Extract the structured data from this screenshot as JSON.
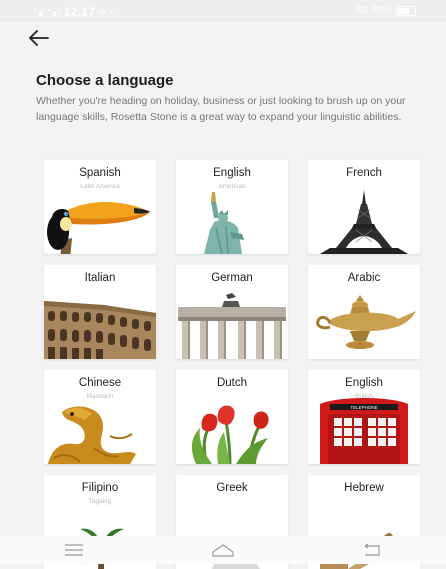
{
  "status_bar": {
    "signal_left": "\"∎",
    "signal_carrier": "\"∎l",
    "time": "12.17",
    "icons": "⟳ ▫",
    "network": "4G",
    "battery_percent": "65%"
  },
  "header": {
    "back_icon": "arrow-left-icon",
    "title": "Choose a language",
    "description": "Whether you're heading on holiday, business or just looking to brush up on your language skills, Rosetta Stone is a great way to expand your linguistic abilities."
  },
  "languages": [
    {
      "name": "Spanish",
      "variant": "Latin America",
      "art": "toucan"
    },
    {
      "name": "English",
      "variant": "American",
      "art": "statue-of-liberty"
    },
    {
      "name": "French",
      "variant": "",
      "art": "eiffel-tower"
    },
    {
      "name": "Italian",
      "variant": "",
      "art": "colosseum"
    },
    {
      "name": "German",
      "variant": "",
      "art": "brandenburg-gate"
    },
    {
      "name": "Arabic",
      "variant": "",
      "art": "oil-lamp"
    },
    {
      "name": "Chinese",
      "variant": "Mandarin",
      "art": "dragon"
    },
    {
      "name": "Dutch",
      "variant": "",
      "art": "tulips"
    },
    {
      "name": "English",
      "variant": "British",
      "art": "telephone-box"
    },
    {
      "name": "Filipino",
      "variant": "Tagalog",
      "art": "palm-tree"
    },
    {
      "name": "Greek",
      "variant": "",
      "art": "greek-statue"
    },
    {
      "name": "Hebrew",
      "variant": "",
      "art": "scroll"
    }
  ],
  "phone_box_sign": "TELEPHONE",
  "nav_bar": {
    "menu_icon": "menu-icon",
    "home_icon": "home-icon",
    "back_icon": "back-icon"
  }
}
